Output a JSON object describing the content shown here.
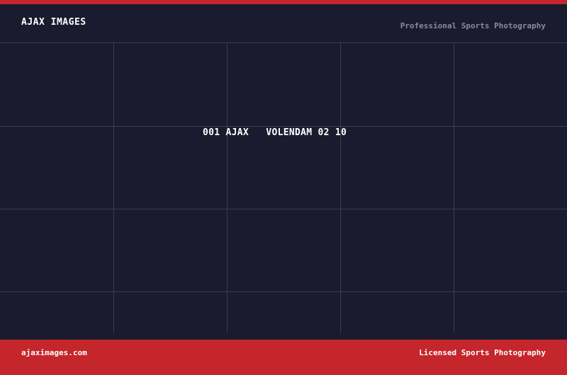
{
  "header": {
    "brand": "AJAX IMAGES",
    "tagline": "Professional Sports Photography"
  },
  "image": {
    "caption": "001 AJAX   VOLENDAM 02 10"
  },
  "footer": {
    "url": "ajaximages.com",
    "license": "Licensed Sports Photography"
  },
  "colors": {
    "background": "#1a1b2e",
    "accent": "#c4262c",
    "grid_line": "#3a3d52",
    "muted_text": "#8a8c98"
  }
}
